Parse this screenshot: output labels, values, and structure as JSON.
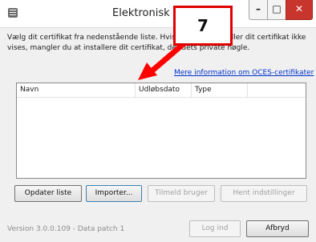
{
  "window": {
    "title": "Elektronisk Id",
    "minimize_glyph": "–",
    "maximize_glyph": "□",
    "close_glyph": "✕"
  },
  "annotation": {
    "badge_number": "7",
    "accent_color": "#e00000"
  },
  "intro_text": "Vælg dit certifikat fra nedenstående liste. Hvis ikke, forbind, eller dit certifikat ikke vises, mangler du at installere dit certifikat, der dets private nøgle.",
  "info_link": "Mere information om OCES-certifikater",
  "certificate_list": {
    "columns": [
      "Navn",
      "Udløbsdato",
      "Type"
    ],
    "rows": []
  },
  "buttons": {
    "update_list": "Opdater liste",
    "import": "Importer...",
    "assign_user": "Tilmeld bruger",
    "fetch_settings": "Hent indstillinger",
    "login": "Log ind",
    "cancel": "Afbryd"
  },
  "version_text": "Version 3.0.0.109 - Data patch 1"
}
